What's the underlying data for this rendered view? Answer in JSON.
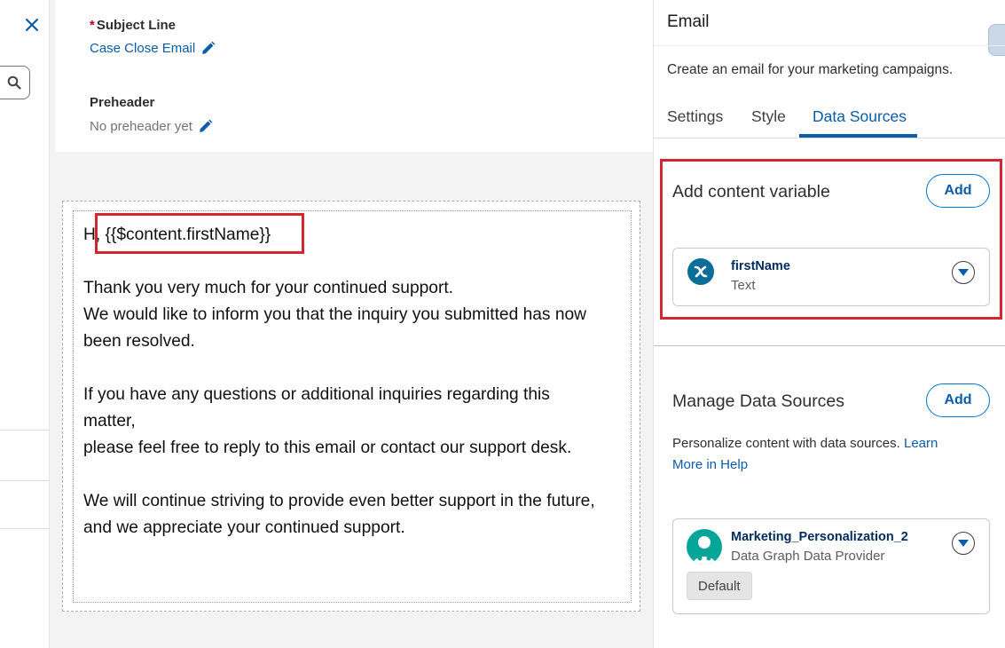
{
  "header": {
    "subject_label": "Subject Line",
    "required_marker": "*",
    "subject_value": "Case Close Email",
    "preheader_label": "Preheader",
    "preheader_value": "No preheader yet"
  },
  "email": {
    "greeting_prefix": "H",
    "greeting_variable": ", {{$content.firstName}}",
    "para1_line1": "Thank you very much for your continued support.",
    "para1_line2": "We would like to inform you that the inquiry you submitted has now",
    "para1_line3": "been resolved.",
    "para2_line1": "If you have any questions or additional inquiries regarding this",
    "para2_line2": "matter,",
    "para2_line3": "please feel free to reply to this email or contact our support desk.",
    "para3_line1": "We will continue striving to provide even better support in the future,",
    "para3_line2": "and we appreciate your continued support."
  },
  "panel": {
    "title": "Email",
    "description": "Create an email for your marketing campaigns.",
    "tabs": [
      {
        "label": "Settings",
        "active": false
      },
      {
        "label": "Style",
        "active": false
      },
      {
        "label": "Data Sources",
        "active": true
      }
    ],
    "content_variable": {
      "title": "Add content variable",
      "add_label": "Add",
      "items": [
        {
          "name": "firstName",
          "type": "Text",
          "icon": "variable-x-icon"
        }
      ]
    },
    "data_sources": {
      "title": "Manage Data Sources",
      "add_label": "Add",
      "description": "Personalize content with data sources.",
      "help_link": "Learn More in Help",
      "items": [
        {
          "name": "Marketing_Personalization_2",
          "type": "Data Graph Data Provider",
          "badge": "Default",
          "icon": "data-provider-avatar-icon"
        }
      ]
    }
  },
  "colors": {
    "accent": "#0b5cab",
    "highlight_box": "#d22630",
    "variable_icon": "#0b6e99",
    "provider_icon": "#06a59a"
  }
}
